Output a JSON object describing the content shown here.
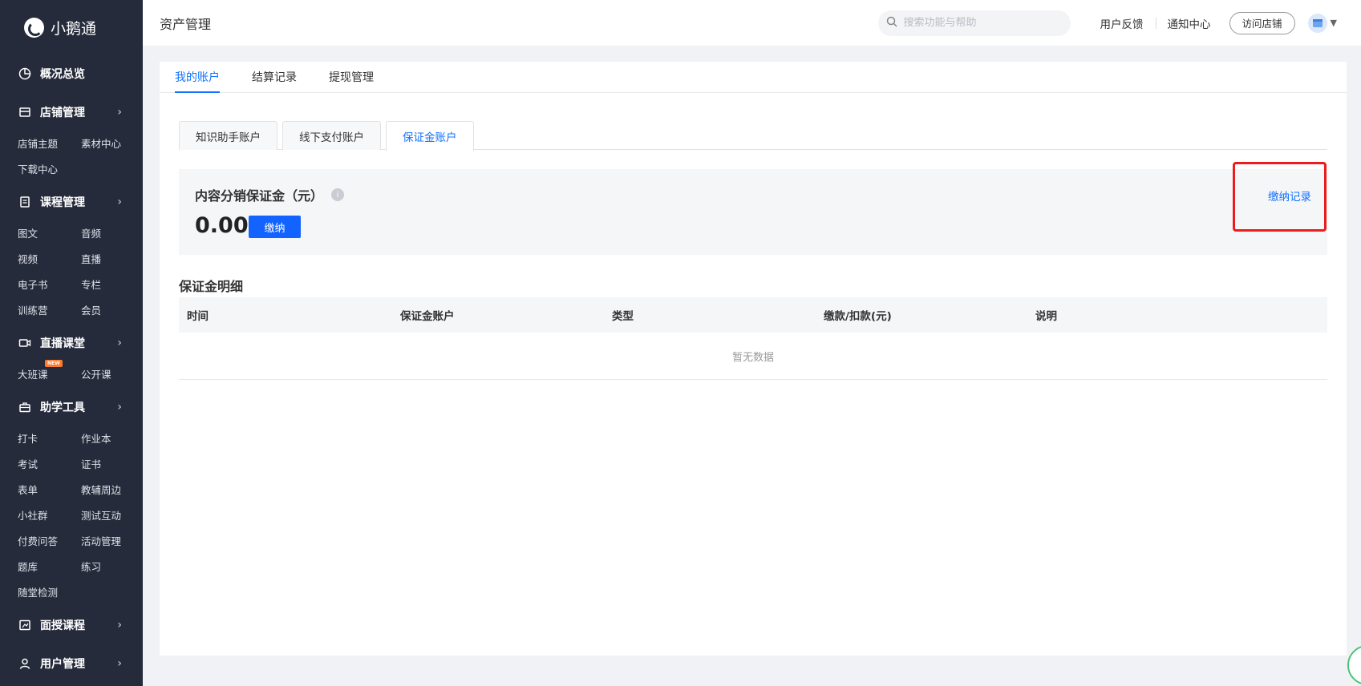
{
  "brand": {
    "name": "小鹅通"
  },
  "sidebar": {
    "sections": [
      {
        "label": "概况总览",
        "icon": "dashboard-icon",
        "items": []
      },
      {
        "label": "店铺管理",
        "icon": "store-icon",
        "items": [
          "店铺主题",
          "素材中心",
          "下载中心"
        ]
      },
      {
        "label": "课程管理",
        "icon": "course-icon",
        "items": [
          "图文",
          "音频",
          "视频",
          "直播",
          "电子书",
          "专栏",
          "训练营",
          "会员"
        ]
      },
      {
        "label": "直播课堂",
        "icon": "live-class-icon",
        "items": [
          "大班课",
          "公开课"
        ],
        "badge": "NEW"
      },
      {
        "label": "助学工具",
        "icon": "toolbox-icon",
        "items": [
          "打卡",
          "作业本",
          "考试",
          "证书",
          "表单",
          "教辅周边",
          "小社群",
          "测试互动",
          "付费问答",
          "活动管理",
          "题库",
          "练习",
          "随堂检测"
        ]
      },
      {
        "label": "面授课程",
        "icon": "offline-course-icon",
        "items": []
      },
      {
        "label": "用户管理",
        "icon": "user-icon",
        "items": []
      }
    ]
  },
  "header": {
    "title": "资产管理",
    "search_placeholder": "搜索功能与帮助",
    "feedback": "用户反馈",
    "notifications": "通知中心",
    "visit_store": "访问店铺"
  },
  "main": {
    "tabs": [
      "我的账户",
      "结算记录",
      "提现管理"
    ],
    "active_tab": 0,
    "subtabs": [
      "知识助手账户",
      "线下支付账户",
      "保证金账户"
    ],
    "active_subtab": 2,
    "deposit": {
      "title": "内容分销保证金（元）",
      "amount": "0.00",
      "pay_label": "缴纳",
      "record_link": "缴纳记录"
    },
    "detail_title": "保证金明细",
    "table": {
      "columns": [
        "时间",
        "保证金账户",
        "类型",
        "缴款/扣款(元)",
        "说明"
      ],
      "rows": [],
      "empty_text": "暂无数据"
    }
  },
  "colors": {
    "accent": "#1472ff",
    "sidebar_bg": "#262b3b",
    "highlight": "#ec1c1c"
  }
}
